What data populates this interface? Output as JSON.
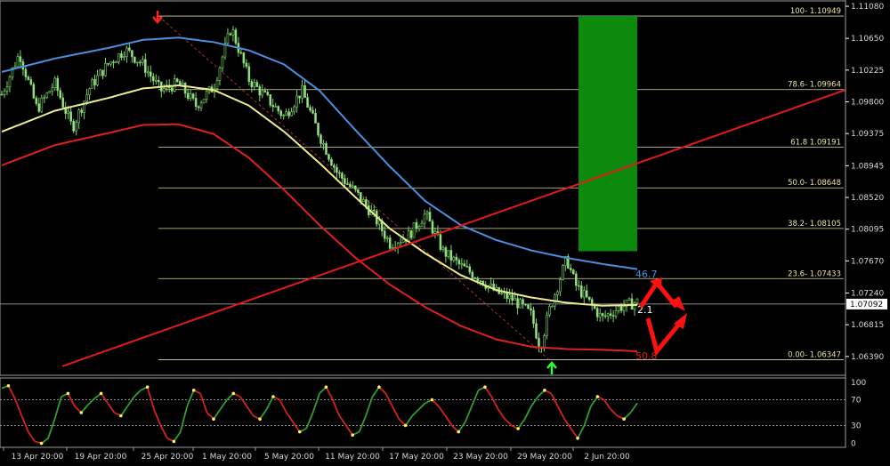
{
  "chart_data": {
    "type": "candlestick",
    "symbol_note": "",
    "price_axis": {
      "ylim": [
        1.0615,
        1.1114
      ],
      "ticks": [
        "1.11080",
        "1.10650",
        "1.10225",
        "1.09800",
        "1.09375",
        "1.08945",
        "1.08520",
        "1.08095",
        "1.07670",
        "1.07240",
        "1.06815",
        "1.06390"
      ],
      "current_price": "1.07092",
      "colors": {
        "tick_line": "#ffffff",
        "box_bg": "#ffffff"
      }
    },
    "time_axis": {
      "labels": [
        "13 Apr 20:00",
        "19 Apr 20:00",
        "25 Apr 20:00",
        "1 May 20:00",
        "5 May 20:00",
        "11 May 20:00",
        "17 May 20:00",
        "23 May 20:00",
        "29 May 20:00",
        "2 Jun 20:00"
      ]
    },
    "fibonacci": {
      "color": "#dcd9a0",
      "levels": [
        {
          "label": "100- 1.10949",
          "price": 1.10949
        },
        {
          "label": "78.6- 1.09964",
          "price": 1.09964
        },
        {
          "label": "61.8 1.09191",
          "price": 1.09191
        },
        {
          "label": "50.0- 1.08648",
          "price": 1.08648
        },
        {
          "label": "38.2- 1.08105",
          "price": 1.08105
        },
        {
          "label": "23.6- 1.07433",
          "price": 1.07433
        },
        {
          "label": "0.00- 1.06347",
          "price": 1.06347
        }
      ]
    },
    "target_box": {
      "color": "#0d8a0d",
      "price_top": 1.10949,
      "price_bottom": 1.078
    },
    "trendline": {
      "color": "#e31a1a",
      "start_price": 1.0626,
      "end_price": 1.0996
    },
    "moving_averages": [
      {
        "color": "#4b8fe0",
        "points": [
          [
            0,
            1.102
          ],
          [
            6,
            1.1038
          ],
          [
            12,
            1.1052
          ],
          [
            16,
            1.1063
          ],
          [
            20,
            1.1066
          ],
          [
            24,
            1.106
          ],
          [
            28,
            1.1049
          ],
          [
            32,
            1.103
          ],
          [
            36,
            1.0995
          ],
          [
            40,
            1.0943
          ],
          [
            44,
            1.0893
          ],
          [
            48,
            1.0847
          ],
          [
            52,
            1.0815
          ],
          [
            56,
            1.0795
          ],
          [
            60,
            1.0781
          ],
          [
            64,
            1.0771
          ],
          [
            68,
            1.0763
          ],
          [
            72,
            1.0756
          ]
        ]
      },
      {
        "color": "#ecec8e",
        "points": [
          [
            0,
            1.094
          ],
          [
            6,
            1.0968
          ],
          [
            12,
            1.0985
          ],
          [
            16,
            1.0998
          ],
          [
            20,
            1.1002
          ],
          [
            24,
            1.0996
          ],
          [
            28,
            1.0975
          ],
          [
            32,
            1.094
          ],
          [
            36,
            1.0898
          ],
          [
            40,
            1.0853
          ],
          [
            44,
            1.081
          ],
          [
            48,
            1.0777
          ],
          [
            52,
            1.0748
          ],
          [
            56,
            1.0728
          ],
          [
            60,
            1.0718
          ],
          [
            64,
            1.0711
          ],
          [
            68,
            1.0707
          ],
          [
            72,
            1.0708
          ]
        ]
      },
      {
        "color": "#e01f1f",
        "points": [
          [
            0,
            1.0895
          ],
          [
            6,
            1.0922
          ],
          [
            12,
            1.0938
          ],
          [
            16,
            1.0949
          ],
          [
            20,
            1.095
          ],
          [
            24,
            1.0937
          ],
          [
            28,
            1.0905
          ],
          [
            32,
            1.0862
          ],
          [
            36,
            1.0815
          ],
          [
            40,
            1.0772
          ],
          [
            44,
            1.0735
          ],
          [
            48,
            1.0705
          ],
          [
            52,
            1.068
          ],
          [
            56,
            1.0662
          ],
          [
            60,
            1.0652
          ],
          [
            64,
            1.0649
          ],
          [
            68,
            1.0648
          ],
          [
            72,
            1.0646
          ]
        ]
      }
    ],
    "price_path": [
      [
        0,
        1.099
      ],
      [
        2,
        1.1045
      ],
      [
        4,
        1.097
      ],
      [
        6,
        1.1005
      ],
      [
        8,
        1.0945
      ],
      [
        10,
        1.1
      ],
      [
        12,
        1.103
      ],
      [
        14,
        1.105
      ],
      [
        16,
        1.103
      ],
      [
        18,
        1.0995
      ],
      [
        20,
        1.1005
      ],
      [
        22,
        1.0975
      ],
      [
        24,
        1.1
      ],
      [
        26,
        1.108
      ],
      [
        28,
        1.101
      ],
      [
        30,
        1.0985
      ],
      [
        32,
        1.096
      ],
      [
        34,
        1.0995
      ],
      [
        36,
        1.0935
      ],
      [
        38,
        1.0885
      ],
      [
        40,
        1.086
      ],
      [
        42,
        1.083
      ],
      [
        44,
        1.079
      ],
      [
        46,
        1.08
      ],
      [
        48,
        1.083
      ],
      [
        50,
        1.078
      ],
      [
        52,
        1.076
      ],
      [
        54,
        1.0745
      ],
      [
        56,
        1.0725
      ],
      [
        58,
        1.0715
      ],
      [
        60,
        1.0695
      ],
      [
        61,
        1.065
      ],
      [
        62,
        1.07
      ],
      [
        64,
        1.077
      ],
      [
        65,
        1.0735
      ],
      [
        66,
        1.072
      ],
      [
        68,
        1.069
      ],
      [
        70,
        1.0705
      ],
      [
        72,
        1.0712
      ]
    ],
    "ma_labels": [
      {
        "text": "46.7",
        "color": "#4b8fe0"
      },
      {
        "text": "2.1",
        "color": "#ffffff"
      },
      {
        "text": "50.8",
        "color": "#e01f1f"
      }
    ],
    "signal_arrows": [
      {
        "color": "#ff2222",
        "direction": "down"
      },
      {
        "color": "#2cff2c",
        "direction": "up"
      }
    ],
    "projection_arrows_color": "#ff1010",
    "oscillator": {
      "levels": [
        "100",
        "70",
        "30",
        "0"
      ],
      "colors": {
        "rising": "#2f9e2f",
        "falling": "#d52020",
        "turn": "#ffee55"
      },
      "values": [
        88,
        92,
        72,
        45,
        20,
        5,
        2,
        10,
        40,
        75,
        80,
        60,
        50,
        62,
        72,
        80,
        65,
        50,
        45,
        60,
        75,
        85,
        90,
        55,
        30,
        10,
        5,
        20,
        60,
        85,
        80,
        50,
        40,
        55,
        70,
        80,
        75,
        60,
        45,
        40,
        55,
        75,
        70,
        50,
        35,
        20,
        25,
        50,
        80,
        90,
        70,
        45,
        30,
        15,
        20,
        45,
        75,
        90,
        80,
        60,
        40,
        30,
        45,
        55,
        65,
        70,
        60,
        45,
        30,
        20,
        35,
        60,
        85,
        90,
        75,
        55,
        40,
        30,
        25,
        40,
        60,
        75,
        85,
        80,
        60,
        40,
        25,
        10,
        30,
        60,
        75,
        70,
        55,
        45,
        40,
        50,
        65
      ]
    }
  }
}
